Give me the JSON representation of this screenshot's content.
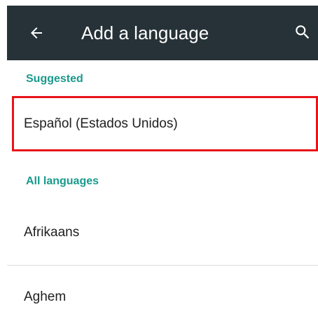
{
  "toolbar": {
    "title": "Add a language",
    "back_icon": "arrow-left-icon",
    "search_icon": "search-icon",
    "background_color": "#263238"
  },
  "sections": {
    "suggested": {
      "header": "Suggested",
      "items": [
        {
          "label": "Español (Estados Unidos)"
        }
      ]
    },
    "all_languages": {
      "header": "All languages",
      "items": [
        {
          "label": "Afrikaans"
        },
        {
          "label": "Aghem"
        }
      ]
    }
  },
  "colors": {
    "accent": "#1a9a8c",
    "highlight": "#e8141a",
    "text": "#202020"
  }
}
